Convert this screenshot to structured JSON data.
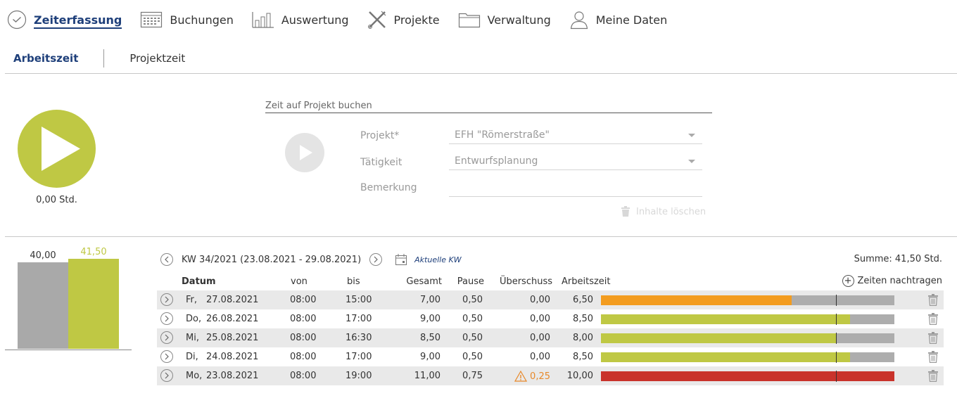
{
  "nav": {
    "items": [
      {
        "label": "Zeiterfassung",
        "icon": "clock-check-icon",
        "active": true
      },
      {
        "label": "Buchungen",
        "icon": "calendar-grid-icon"
      },
      {
        "label": "Auswertung",
        "icon": "bar-chart-icon"
      },
      {
        "label": "Projekte",
        "icon": "tools-icon"
      },
      {
        "label": "Verwaltung",
        "icon": "folder-icon"
      },
      {
        "label": "Meine Daten",
        "icon": "user-icon"
      }
    ]
  },
  "subtabs": [
    {
      "label": "Arbeitszeit",
      "active": true
    },
    {
      "label": "Projektzeit"
    }
  ],
  "timer": {
    "value": "0,00 Std."
  },
  "booking": {
    "title": "Zeit auf Projekt buchen",
    "project_label": "Projekt*",
    "project_value": "EFH \"Römerstraße\"",
    "activity_label": "Tätigkeit",
    "activity_value": "Entwurfsplanung",
    "remark_label": "Bemerkung",
    "remark_value": "",
    "clear_label": "Inhalte löschen"
  },
  "summary_chart": {
    "target": {
      "label": "40,00",
      "value": 40.0,
      "color": "#a9a9a9"
    },
    "actual": {
      "label": "41,50",
      "value": 41.5,
      "color": "#bfc844"
    }
  },
  "week": {
    "label": "KW 34/2021 (23.08.2021 - 29.08.2021)",
    "current_label": "Aktuelle KW",
    "sum_label": "Summe: 41,50 Std."
  },
  "table": {
    "headers": {
      "datum": "Datum",
      "von": "von",
      "bis": "bis",
      "gesamt": "Gesamt",
      "pause": "Pause",
      "ueberschuss": "Überschuss",
      "arbeitszeit": "Arbeitszeit"
    },
    "add_label": "Zeiten nachtragen",
    "target_hours": 8.0,
    "bar_max_hours": 10.0,
    "rows": [
      {
        "day": "Fr,",
        "date": "27.08.2021",
        "von": "08:00",
        "bis": "15:00",
        "gesamt": "7,00",
        "pause": "0,50",
        "ueberschuss": "0,00",
        "arbeitszeit": "6,50",
        "hours": 6.5,
        "color": "#f39c1f",
        "warning": false
      },
      {
        "day": "Do,",
        "date": "26.08.2021",
        "von": "08:00",
        "bis": "17:00",
        "gesamt": "9,00",
        "pause": "0,50",
        "ueberschuss": "0,00",
        "arbeitszeit": "8,50",
        "hours": 8.5,
        "color": "#bfc844",
        "warning": false
      },
      {
        "day": "Mi,",
        "date": "25.08.2021",
        "von": "08:00",
        "bis": "16:30",
        "gesamt": "8,50",
        "pause": "0,50",
        "ueberschuss": "0,00",
        "arbeitszeit": "8,00",
        "hours": 8.0,
        "color": "#bfc844",
        "warning": false
      },
      {
        "day": "Di,",
        "date": "24.08.2021",
        "von": "08:00",
        "bis": "17:00",
        "gesamt": "9,00",
        "pause": "0,50",
        "ueberschuss": "0,00",
        "arbeitszeit": "8,50",
        "hours": 8.5,
        "color": "#bfc844",
        "warning": false
      },
      {
        "day": "Mo,",
        "date": "23.08.2021",
        "von": "08:00",
        "bis": "19:00",
        "gesamt": "11,00",
        "pause": "0,75",
        "ueberschuss": "0,25",
        "arbeitszeit": "10,00",
        "hours": 10.0,
        "color": "#c9332b",
        "warning": true
      }
    ]
  }
}
